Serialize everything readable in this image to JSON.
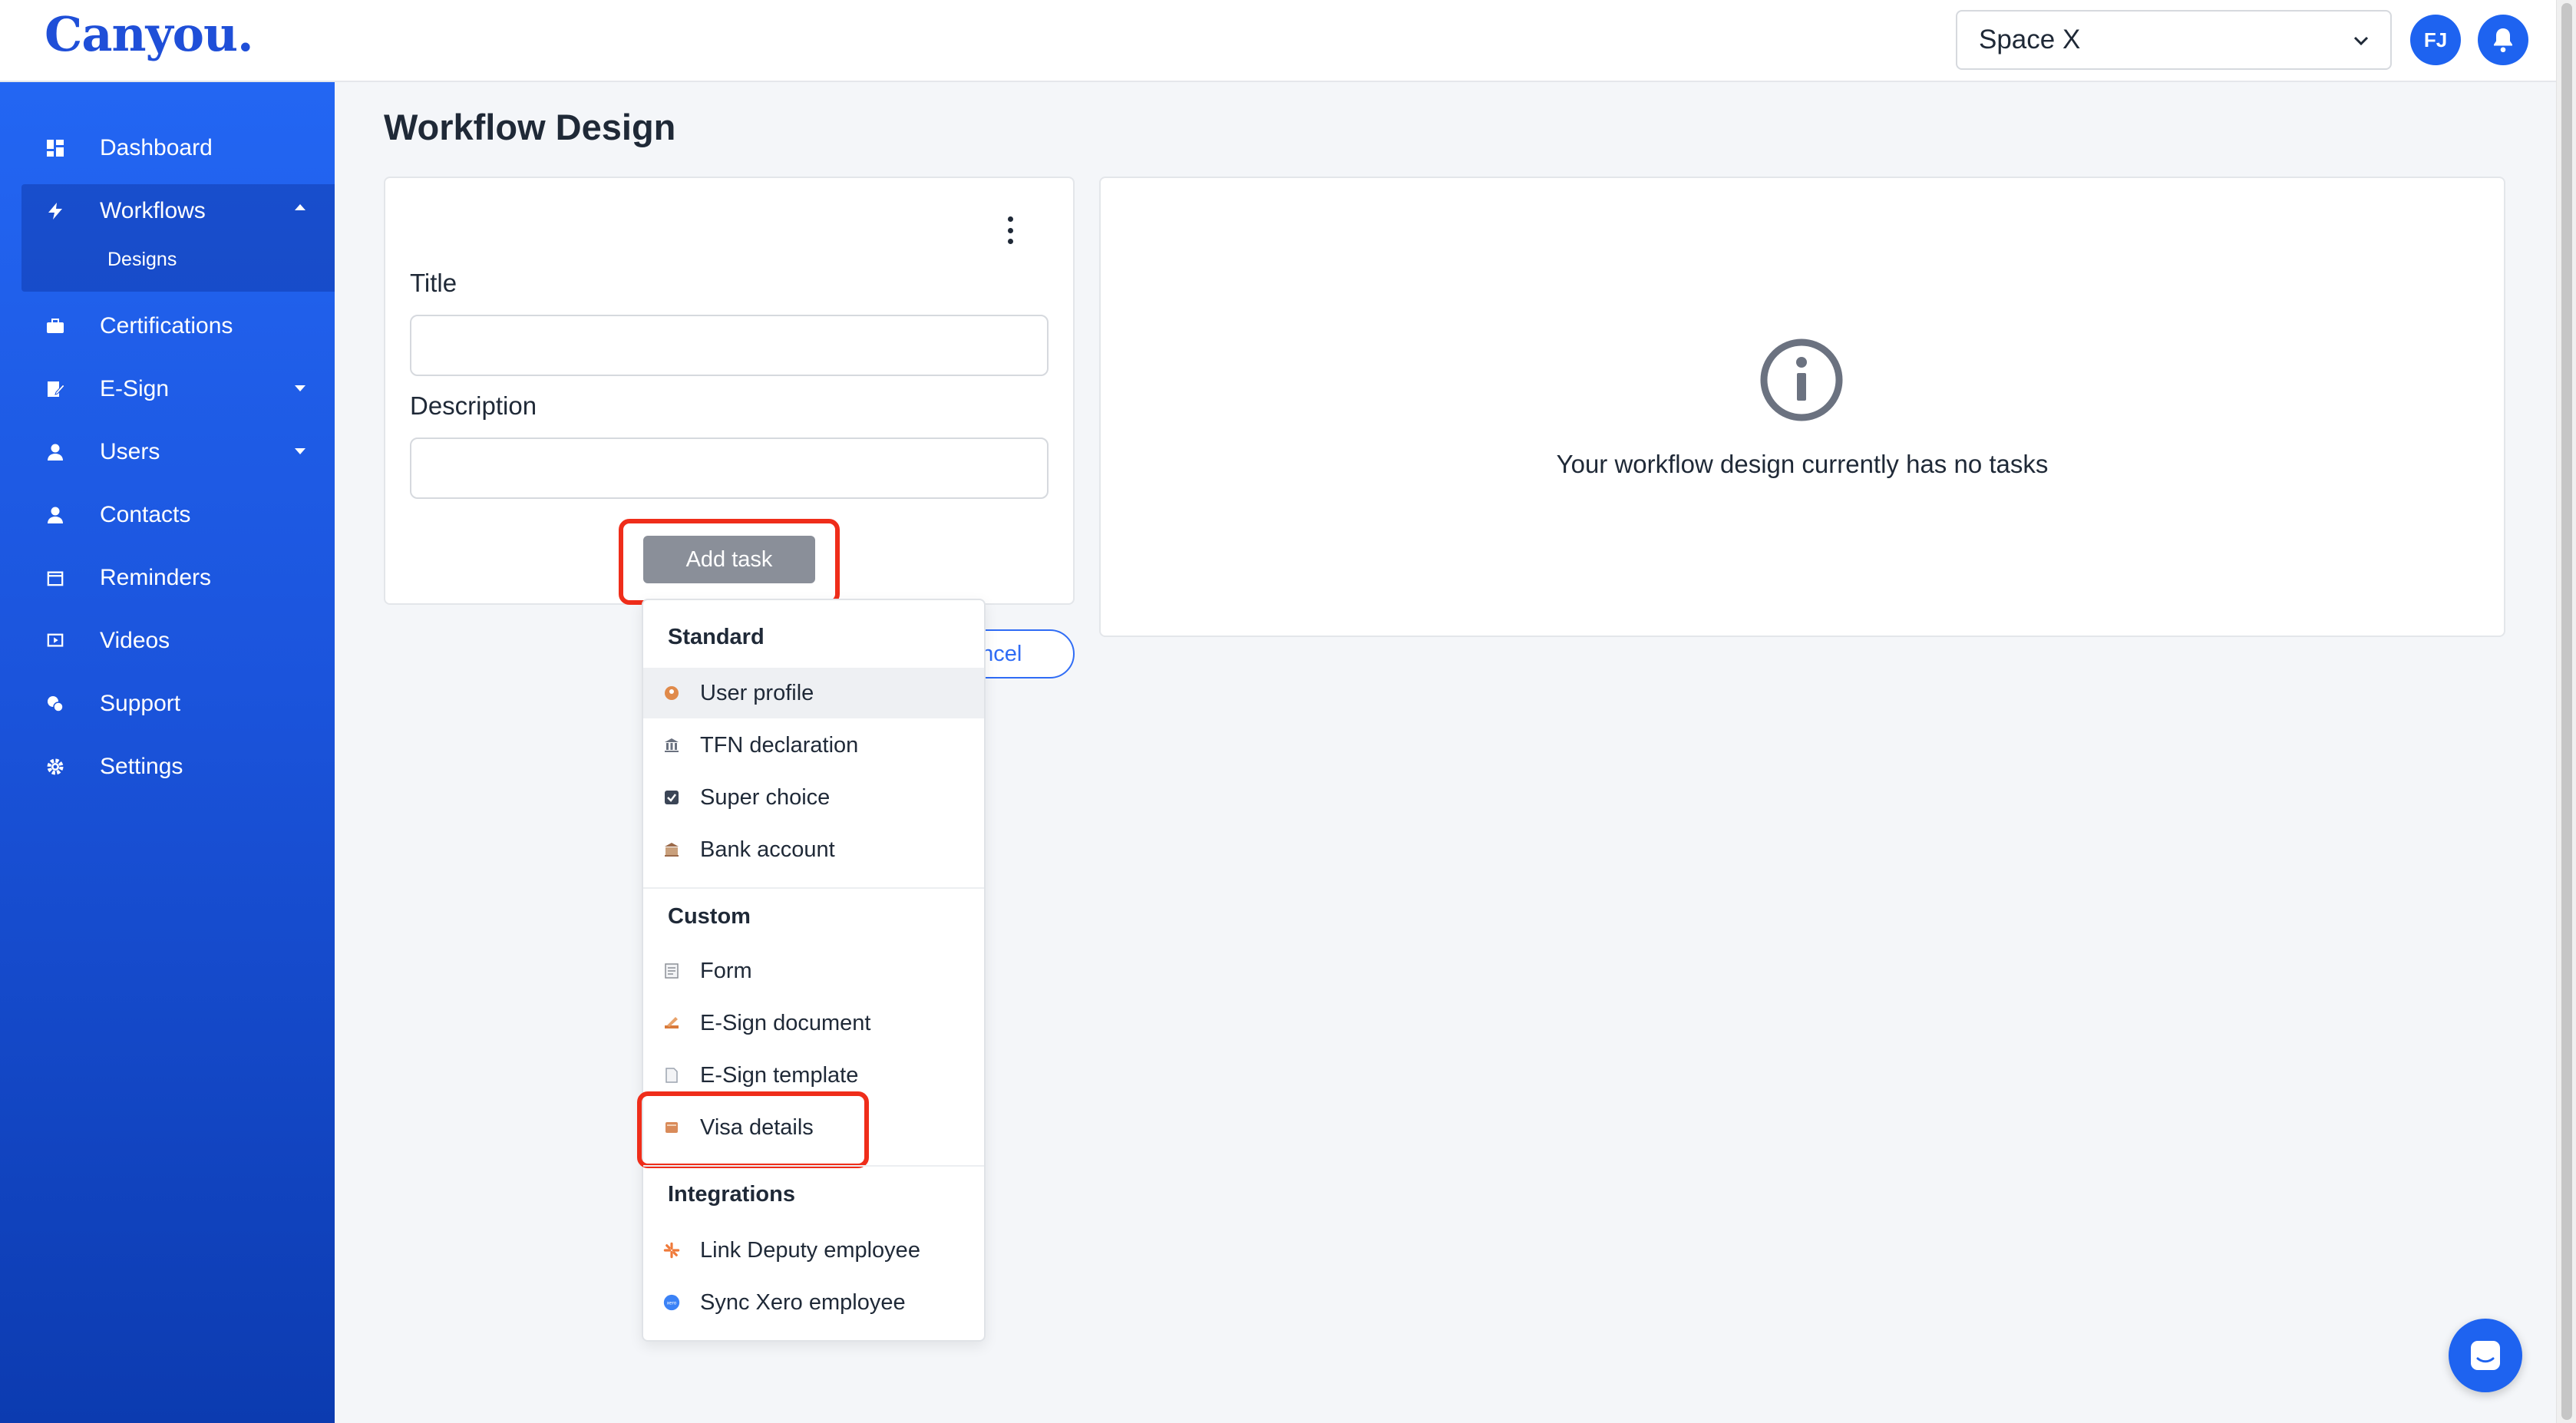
{
  "app": {
    "logo": "Canyou.",
    "space_select": "Space X",
    "user_initials": "FJ"
  },
  "sidebar": {
    "items": [
      {
        "label": "Dashboard",
        "icon": "dashboard-icon"
      },
      {
        "label": "Workflows",
        "icon": "bolt-icon",
        "expanded": true
      },
      {
        "label": "Certifications",
        "icon": "briefcase-icon"
      },
      {
        "label": "E-Sign",
        "icon": "sign-icon",
        "has_children": true
      },
      {
        "label": "Users",
        "icon": "user-icon",
        "has_children": true
      },
      {
        "label": "Contacts",
        "icon": "contact-icon"
      },
      {
        "label": "Reminders",
        "icon": "calendar-icon"
      },
      {
        "label": "Videos",
        "icon": "video-icon"
      },
      {
        "label": "Support",
        "icon": "support-icon"
      },
      {
        "label": "Settings",
        "icon": "gear-icon"
      }
    ],
    "sub_items": [
      {
        "label": "Designs"
      }
    ]
  },
  "main": {
    "page_title": "Workflow Design",
    "form": {
      "title_label": "Title",
      "title_value": "",
      "description_label": "Description",
      "description_value": "",
      "add_task_label": "Add task",
      "cancel_label": "ancel"
    },
    "empty_state": {
      "icon": "info-icon",
      "text": "Your workflow design currently has no tasks"
    }
  },
  "dropdown": {
    "sections": [
      {
        "header": "Standard",
        "items": [
          "User profile",
          "TFN declaration",
          "Super choice",
          "Bank account"
        ]
      },
      {
        "header": "Custom",
        "items": [
          "Form",
          "E-Sign document",
          "E-Sign template",
          "Visa details"
        ]
      },
      {
        "header": "Integrations",
        "items": [
          "Link Deputy employee",
          "Sync Xero employee"
        ]
      }
    ]
  },
  "colors": {
    "accent": "#1e63f0",
    "highlight": "#ef2d1a",
    "sidebar_top": "#2366f3",
    "sidebar_bottom": "#0c3bb0"
  }
}
